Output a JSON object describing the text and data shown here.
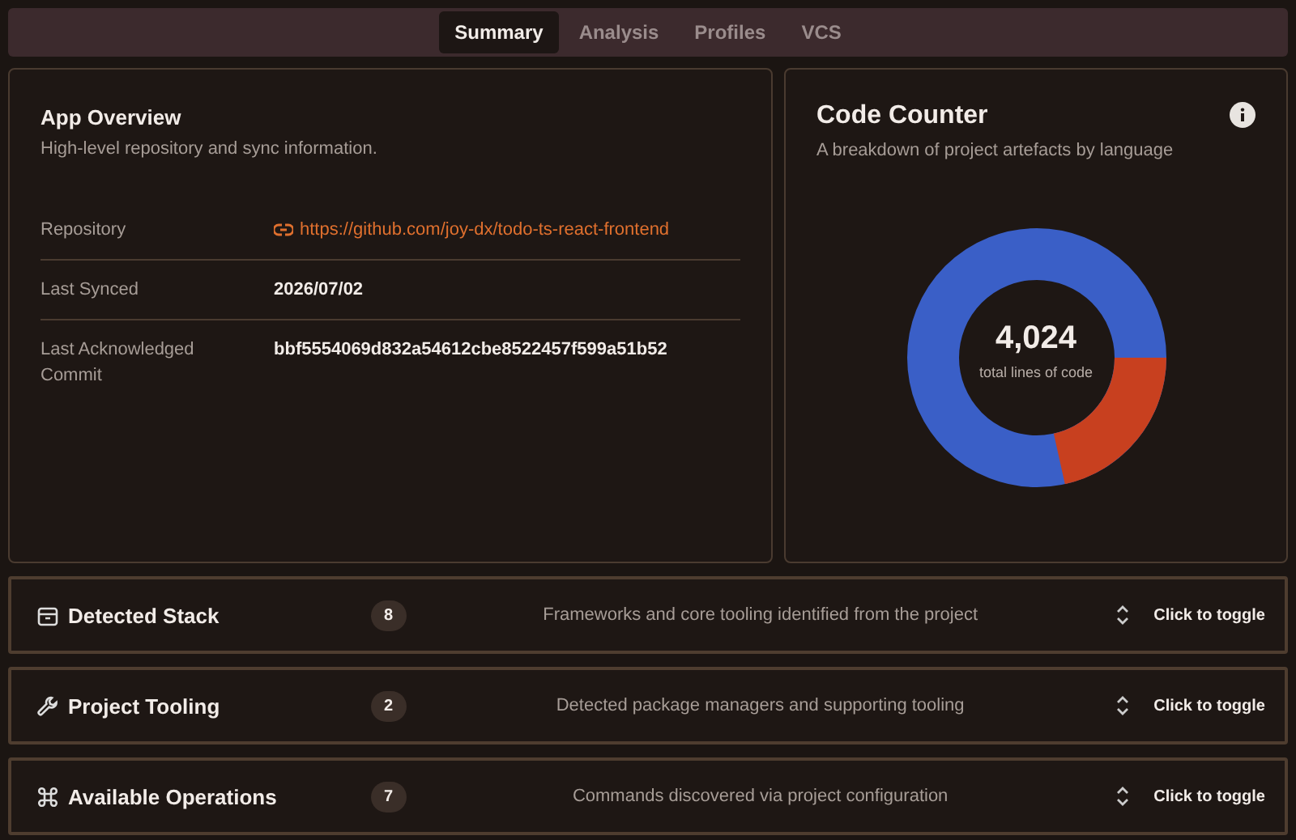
{
  "tabs": [
    {
      "label": "Summary",
      "selected": true
    },
    {
      "label": "Analysis",
      "selected": false
    },
    {
      "label": "Profiles",
      "selected": false
    },
    {
      "label": "VCS",
      "selected": false
    }
  ],
  "overview": {
    "title": "App Overview",
    "subtitle": "High-level repository and sync information.",
    "rows": [
      {
        "label": "Repository",
        "value": "https://github.com/joy-dx/todo-ts-react-frontend",
        "kind": "link"
      },
      {
        "label": "Last Synced",
        "value": "2026/07/02",
        "kind": "text"
      },
      {
        "label": "Last Acknowledged Commit",
        "value": "bbf5554069d832a54612cbe8522457f599a51b52",
        "kind": "text"
      }
    ]
  },
  "code_counter": {
    "title": "Code Counter",
    "subtitle": "A breakdown of project artefacts by language",
    "total": "4,024",
    "total_label": "total lines of code"
  },
  "sections": [
    {
      "title": "Detected Stack",
      "count": "8",
      "description": "Frameworks and core tooling identified from the project",
      "toggle": "Click to toggle",
      "expanded": false
    },
    {
      "title": "Project Tooling",
      "count": "2",
      "description": "Detected package managers and supporting tooling",
      "toggle": "Click to toggle",
      "expanded": false
    },
    {
      "title": "Available Operations",
      "count": "7",
      "description": "Commands discovered via project configuration",
      "toggle": "Click to toggle",
      "expanded": false
    }
  ]
}
